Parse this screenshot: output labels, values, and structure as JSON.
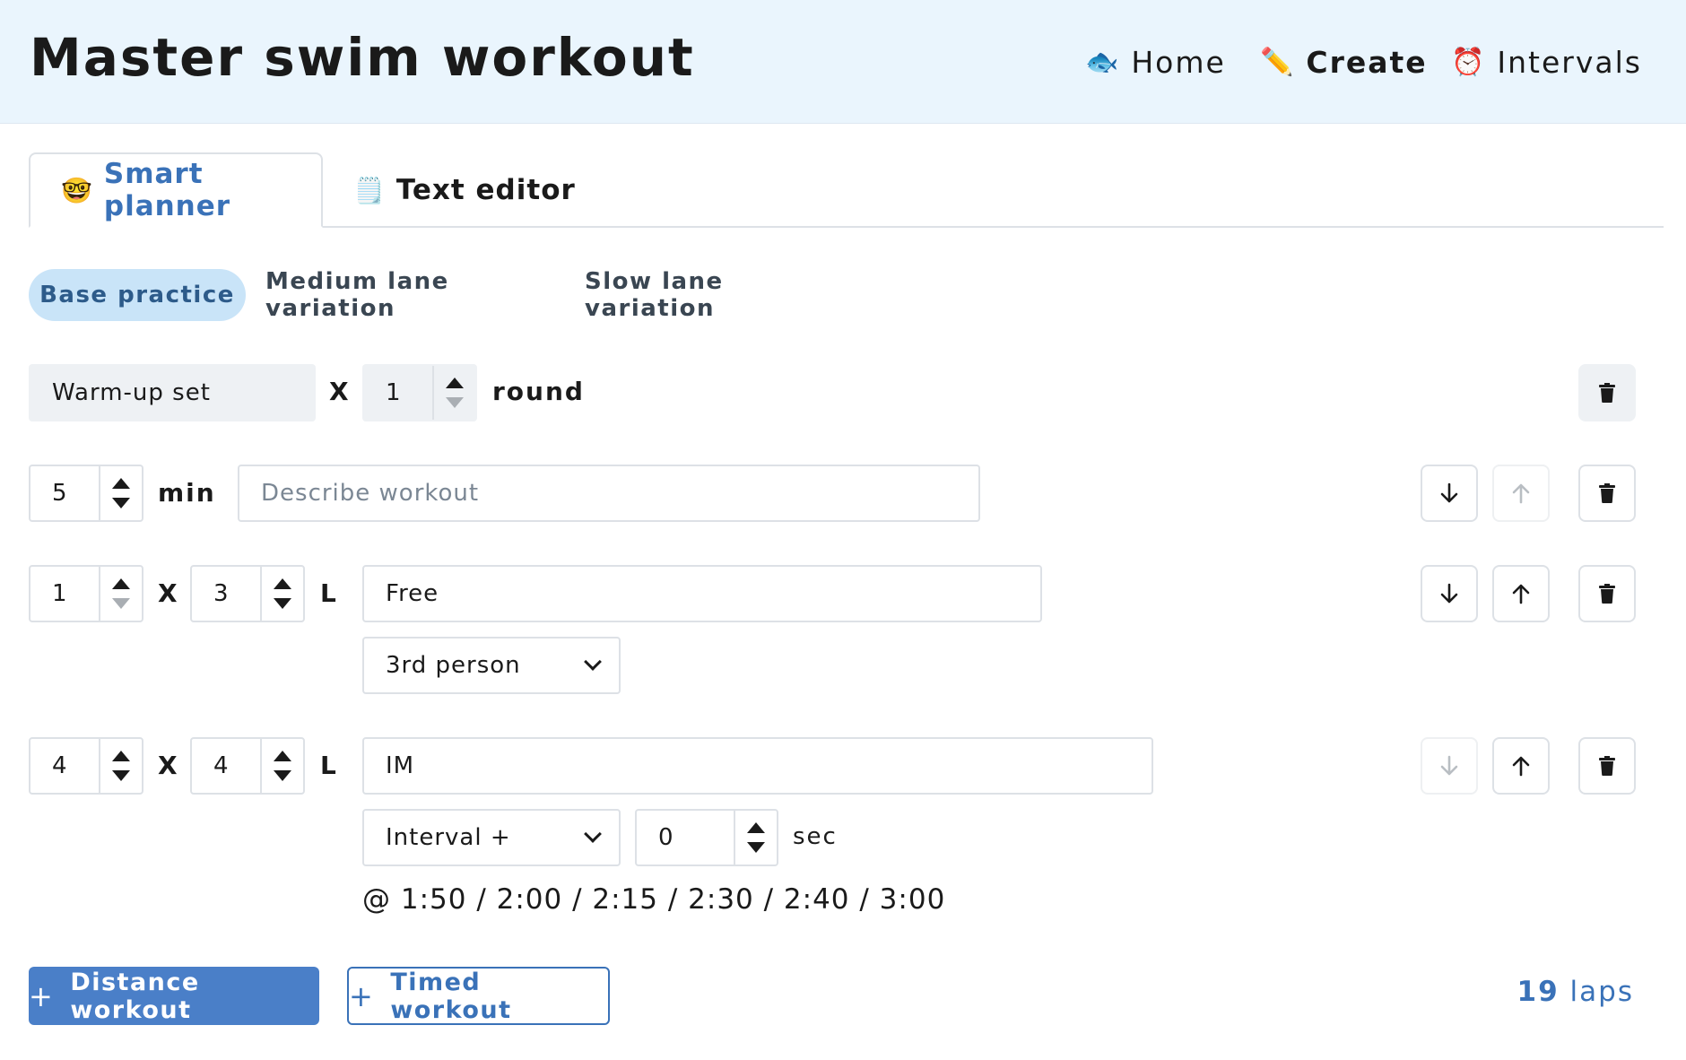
{
  "header": {
    "title": "Master swim workout",
    "nav": [
      {
        "icon": "fish-icon",
        "emoji": "🐟",
        "label": "Home"
      },
      {
        "icon": "pencil-icon",
        "emoji": "✏️",
        "label": "Create"
      },
      {
        "icon": "alarm-clock-icon",
        "emoji": "⏰",
        "label": "Intervals"
      }
    ]
  },
  "tabs": [
    {
      "icon": "nerd-face-icon",
      "emoji": "🤓",
      "label": "Smart planner"
    },
    {
      "icon": "notepad-icon",
      "emoji": "🗒️",
      "label": "Text editor"
    }
  ],
  "variations": [
    "Base practice",
    "Medium lane variation",
    "Slow lane variation"
  ],
  "set": {
    "name": "Warm-up set",
    "x_label": "X",
    "rounds": "1",
    "rounds_label": "round"
  },
  "rows": {
    "timed": {
      "minutes": "5",
      "unit": "min",
      "placeholder": "Describe workout"
    },
    "free": {
      "reps": "1",
      "x_label": "X",
      "laps": "3",
      "unit": "L",
      "description": "Free",
      "select": "3rd person"
    },
    "im": {
      "reps": "4",
      "x_label": "X",
      "laps": "4",
      "unit": "L",
      "description": "IM",
      "select": "Interval +",
      "seconds": "0",
      "sec_label": "sec",
      "intervals": "@ 1:50 / 2:00 / 2:15 / 2:30 / 2:40 / 3:00"
    }
  },
  "buttons": {
    "distance": "Distance workout",
    "timed": "Timed workout"
  },
  "summary": {
    "count": "19",
    "unit": "laps"
  },
  "colors": {
    "accent": "#4a7fc8",
    "header_bg": "#eaf5fd",
    "pill_active": "#c9e4f8"
  }
}
